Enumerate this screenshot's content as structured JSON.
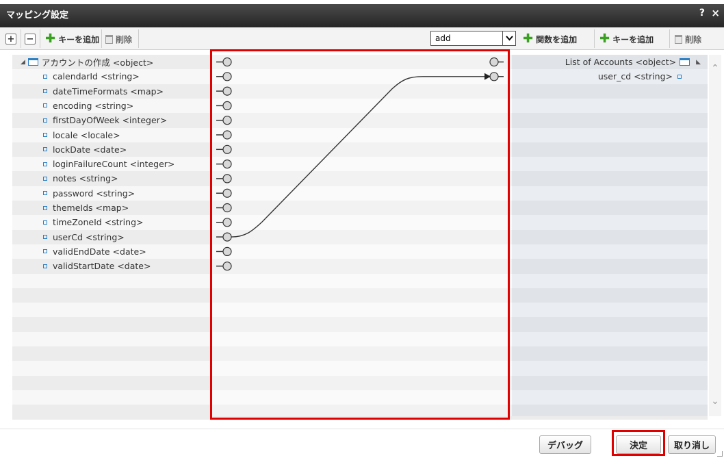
{
  "window": {
    "title": "マッピング設定",
    "help": "?",
    "close": "×"
  },
  "toolbar": {
    "expand": "+",
    "collapse": "−",
    "add_key_left": "キーを追加",
    "delete_left": "削除",
    "function_select": "add",
    "add_function": "関数を追加",
    "add_key_right": "キーを追加",
    "delete_right": "削除"
  },
  "source": {
    "root": "アカウントの作成 <object>",
    "fields": [
      "calendarId <string>",
      "dateTimeFormats <map>",
      "encoding <string>",
      "firstDayOfWeek <integer>",
      "locale <locale>",
      "lockDate <date>",
      "loginFailureCount <integer>",
      "notes <string>",
      "password <string>",
      "themeIds <map>",
      "timeZoneId <string>",
      "userCd <string>",
      "validEndDate <date>",
      "validStartDate <date>"
    ]
  },
  "target": {
    "root": "List of Accounts <object>",
    "fields": [
      "user_cd <string>"
    ]
  },
  "mappings": [
    {
      "from": "userCd <string>",
      "to": "user_cd <string>"
    }
  ],
  "footer": {
    "debug": "デバッグ",
    "ok": "決定",
    "cancel": "取り消し"
  },
  "colors": {
    "highlight": "#e00000",
    "titlebar": "#333333",
    "node_icon": "#2a7fc4",
    "add_icon": "#3aa020"
  }
}
